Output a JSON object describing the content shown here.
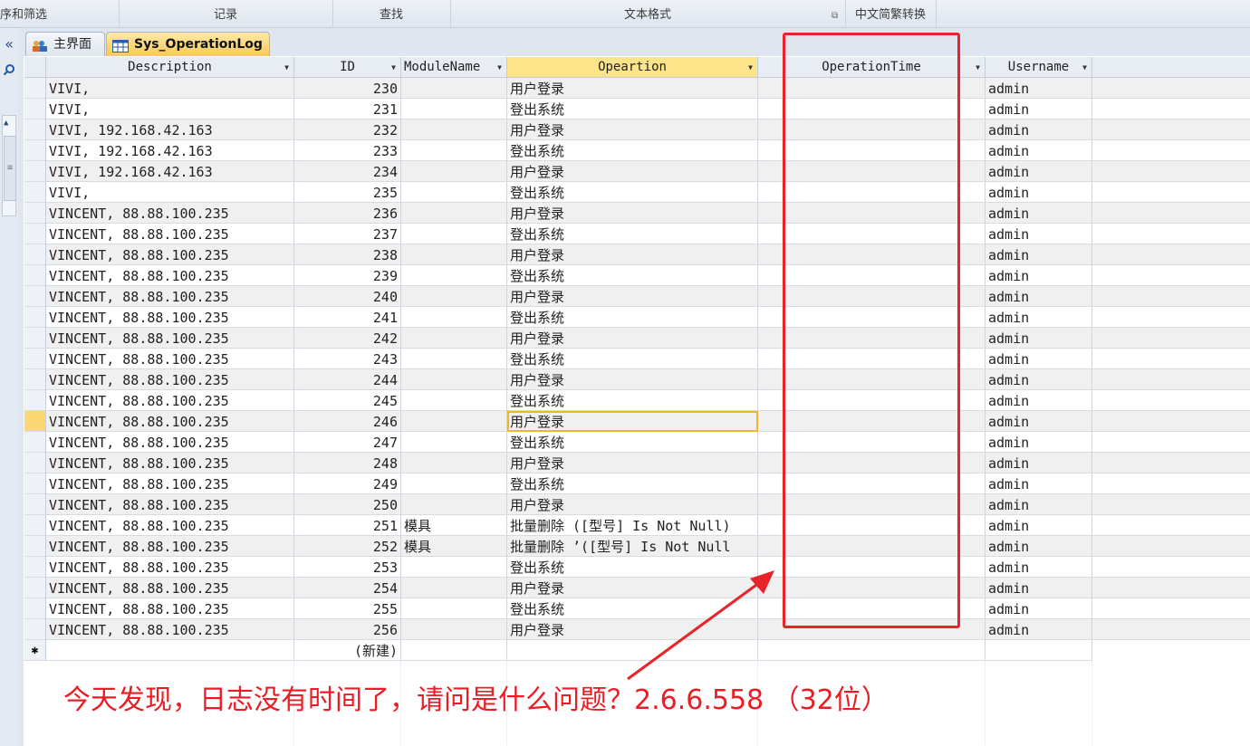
{
  "ribbon": {
    "groups": [
      {
        "label": "序和筛选"
      },
      {
        "label": "记录"
      },
      {
        "label": "查找"
      },
      {
        "label": "文本格式"
      },
      {
        "label": "中文简繁转换"
      }
    ]
  },
  "nav": {
    "collapse_glyph": "«",
    "search_icon": "search-icon"
  },
  "tabs": [
    {
      "label": "主界面",
      "icon": "form-icon",
      "active": false
    },
    {
      "label": "Sys_OperationLog",
      "icon": "table-icon",
      "active": true
    }
  ],
  "columns": [
    {
      "label": "Description",
      "selected": false
    },
    {
      "label": "ID",
      "selected": false
    },
    {
      "label": "ModuleName",
      "selected": false
    },
    {
      "label": "Opeartion",
      "selected": true
    },
    {
      "label": "OperationTime",
      "selected": false
    },
    {
      "label": "Username",
      "selected": false
    }
  ],
  "rows": [
    {
      "description": "VIVI,",
      "id": "230",
      "module": "",
      "operation": "用户登录",
      "time": "",
      "user": "admin"
    },
    {
      "description": "VIVI,",
      "id": "231",
      "module": "",
      "operation": "登出系统",
      "time": "",
      "user": "admin"
    },
    {
      "description": "VIVI, 192.168.42.163",
      "id": "232",
      "module": "",
      "operation": "用户登录",
      "time": "",
      "user": "admin"
    },
    {
      "description": "VIVI, 192.168.42.163",
      "id": "233",
      "module": "",
      "operation": "登出系统",
      "time": "",
      "user": "admin"
    },
    {
      "description": "VIVI, 192.168.42.163",
      "id": "234",
      "module": "",
      "operation": "用户登录",
      "time": "",
      "user": "admin"
    },
    {
      "description": "VIVI,",
      "id": "235",
      "module": "",
      "operation": "登出系统",
      "time": "",
      "user": "admin"
    },
    {
      "description": "VINCENT, 88.88.100.235",
      "id": "236",
      "module": "",
      "operation": "用户登录",
      "time": "",
      "user": "admin"
    },
    {
      "description": "VINCENT, 88.88.100.235",
      "id": "237",
      "module": "",
      "operation": "登出系统",
      "time": "",
      "user": "admin"
    },
    {
      "description": "VINCENT, 88.88.100.235",
      "id": "238",
      "module": "",
      "operation": "用户登录",
      "time": "",
      "user": "admin"
    },
    {
      "description": "VINCENT, 88.88.100.235",
      "id": "239",
      "module": "",
      "operation": "登出系统",
      "time": "",
      "user": "admin"
    },
    {
      "description": "VINCENT, 88.88.100.235",
      "id": "240",
      "module": "",
      "operation": "用户登录",
      "time": "",
      "user": "admin"
    },
    {
      "description": "VINCENT, 88.88.100.235",
      "id": "241",
      "module": "",
      "operation": "登出系统",
      "time": "",
      "user": "admin"
    },
    {
      "description": "VINCENT, 88.88.100.235",
      "id": "242",
      "module": "",
      "operation": "用户登录",
      "time": "",
      "user": "admin"
    },
    {
      "description": "VINCENT, 88.88.100.235",
      "id": "243",
      "module": "",
      "operation": "登出系统",
      "time": "",
      "user": "admin"
    },
    {
      "description": "VINCENT, 88.88.100.235",
      "id": "244",
      "module": "",
      "operation": "用户登录",
      "time": "",
      "user": "admin"
    },
    {
      "description": "VINCENT, 88.88.100.235",
      "id": "245",
      "module": "",
      "operation": "登出系统",
      "time": "",
      "user": "admin"
    },
    {
      "description": "VINCENT, 88.88.100.235",
      "id": "246",
      "module": "",
      "operation": "用户登录",
      "time": "",
      "user": "admin",
      "current": true
    },
    {
      "description": "VINCENT, 88.88.100.235",
      "id": "247",
      "module": "",
      "operation": "登出系统",
      "time": "",
      "user": "admin"
    },
    {
      "description": "VINCENT, 88.88.100.235",
      "id": "248",
      "module": "",
      "operation": "用户登录",
      "time": "",
      "user": "admin"
    },
    {
      "description": "VINCENT, 88.88.100.235",
      "id": "249",
      "module": "",
      "operation": "登出系统",
      "time": "",
      "user": "admin"
    },
    {
      "description": "VINCENT, 88.88.100.235",
      "id": "250",
      "module": "",
      "operation": "用户登录",
      "time": "",
      "user": "admin"
    },
    {
      "description": "VINCENT, 88.88.100.235",
      "id": "251",
      "module": "模具",
      "operation": "批量删除 ([型号] Is Not Null)",
      "time": "",
      "user": "admin"
    },
    {
      "description": "VINCENT, 88.88.100.235",
      "id": "252",
      "module": "模具",
      "operation": "批量删除 ’([型号] Is Not Null",
      "time": "",
      "user": "admin"
    },
    {
      "description": "VINCENT, 88.88.100.235",
      "id": "253",
      "module": "",
      "operation": "登出系统",
      "time": "",
      "user": "admin"
    },
    {
      "description": "VINCENT, 88.88.100.235",
      "id": "254",
      "module": "",
      "operation": "用户登录",
      "time": "",
      "user": "admin"
    },
    {
      "description": "VINCENT, 88.88.100.235",
      "id": "255",
      "module": "",
      "operation": "登出系统",
      "time": "",
      "user": "admin"
    },
    {
      "description": "VINCENT, 88.88.100.235",
      "id": "256",
      "module": "",
      "operation": "用户登录",
      "time": "",
      "user": "admin"
    }
  ],
  "new_row": {
    "marker": "✱",
    "id_placeholder": "(新建)"
  },
  "annotation": {
    "text": "今天发现，日志没有时间了，请问是什么问题？2.6.6.558 （32位）",
    "color": "#ec1c24"
  },
  "colors": {
    "selected_header": "#fbe48a",
    "focus_cell": "#a9c6e8",
    "current_row": "#fcd775"
  }
}
